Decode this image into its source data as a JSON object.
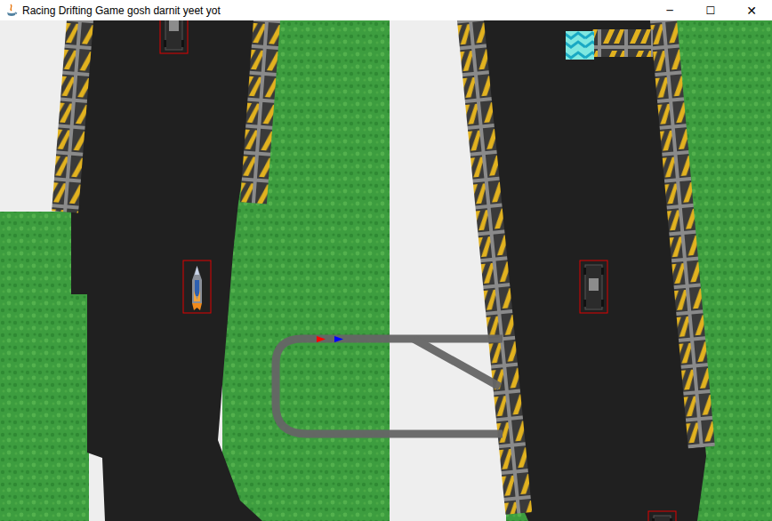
{
  "window": {
    "title": "Racing Drifting Game gosh darnit yeet yot",
    "controls": [
      "─",
      "☐",
      "✕"
    ]
  },
  "viewports": [
    {
      "name": "player-1-view",
      "cars": [
        {
          "kind": "truck"
        },
        {
          "kind": "rocket"
        }
      ]
    },
    {
      "name": "player-2-view",
      "cars": [
        {
          "kind": "truck"
        },
        {
          "kind": "truck"
        }
      ]
    }
  ],
  "minimap": {
    "markers": [
      {
        "color": "#ff0000"
      },
      {
        "color": "#0000ff"
      }
    ]
  }
}
